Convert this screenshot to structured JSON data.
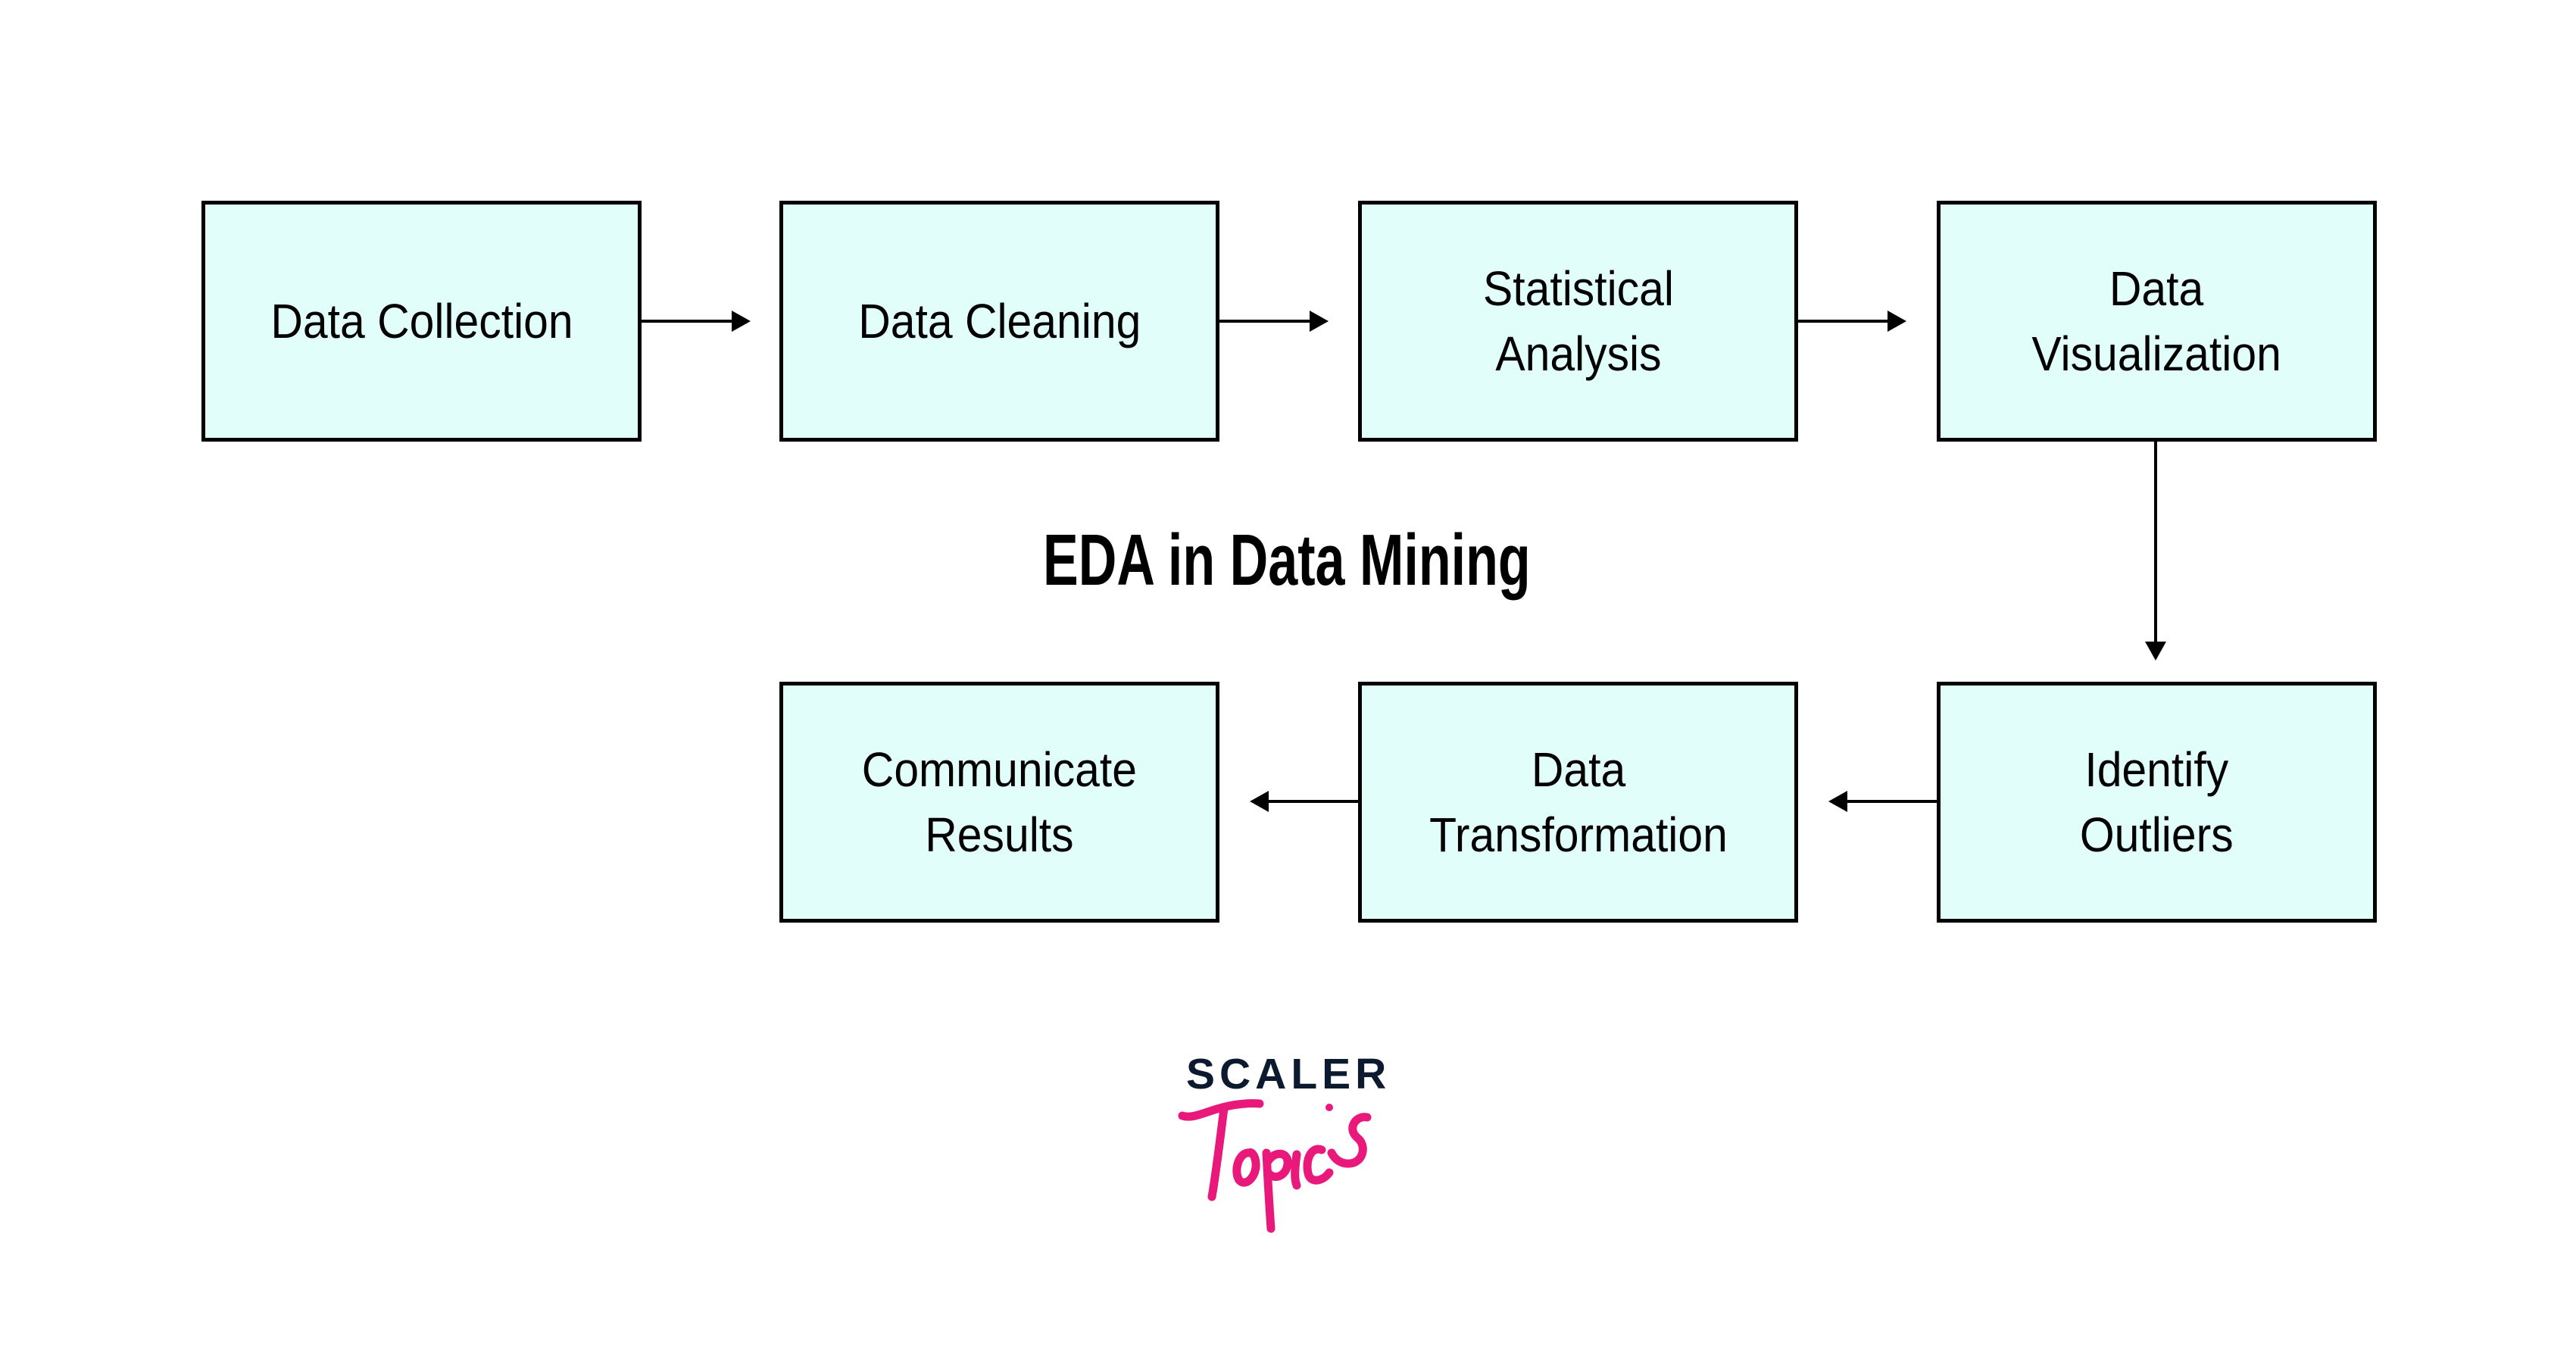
{
  "diagram": {
    "title": "EDA in Data Mining",
    "colors": {
      "box_fill": "#e2fefb",
      "box_border": "#000000",
      "arrow": "#000000",
      "logo_dark": "#0b1a2e",
      "logo_pink": "#e8197a"
    },
    "steps": [
      {
        "id": "data-collection",
        "lines": [
          "Data Collection"
        ]
      },
      {
        "id": "data-cleaning",
        "lines": [
          "Data Cleaning"
        ]
      },
      {
        "id": "statistical-analysis",
        "lines": [
          "Statistical",
          "Analysis"
        ]
      },
      {
        "id": "data-visualization",
        "lines": [
          "Data",
          "Visualization"
        ]
      },
      {
        "id": "identify-outliers",
        "lines": [
          "Identify",
          "Outliers"
        ]
      },
      {
        "id": "data-transformation",
        "lines": [
          "Data",
          "Transformation"
        ]
      },
      {
        "id": "communicate-results",
        "lines": [
          "Communicate",
          "Results"
        ]
      }
    ],
    "edges": [
      {
        "from": "data-collection",
        "to": "data-cleaning"
      },
      {
        "from": "data-cleaning",
        "to": "statistical-analysis"
      },
      {
        "from": "statistical-analysis",
        "to": "data-visualization"
      },
      {
        "from": "data-visualization",
        "to": "identify-outliers"
      },
      {
        "from": "identify-outliers",
        "to": "data-transformation"
      },
      {
        "from": "data-transformation",
        "to": "communicate-results"
      }
    ]
  },
  "logo": {
    "brand": "SCALER",
    "product": "Topics"
  }
}
